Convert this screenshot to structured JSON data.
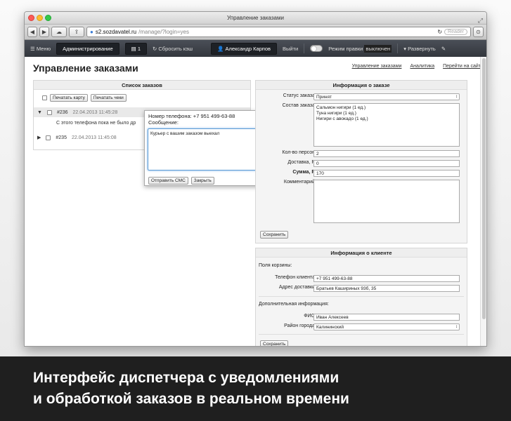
{
  "window": {
    "title": "Управление заказами"
  },
  "browser": {
    "url_host": "s2.sozdavatel.ru",
    "url_path": "/manage/?login=yes",
    "reader_label": "Reader"
  },
  "adminbar": {
    "menu": "Меню",
    "admin": "Администрирование",
    "badge": "1",
    "reset_cache": "Сбросить кэш",
    "user": "Александр Карпов",
    "logout": "Выйти",
    "edit_mode_label": "Режим правки",
    "edit_mode_state": "выключен",
    "expand": "Развернуть"
  },
  "page": {
    "title": "Управление заказами",
    "links": [
      "Управление заказами",
      "Аналитика",
      "Перейти на сайт"
    ]
  },
  "orders": {
    "title": "Список заказов",
    "print_card": "Печатать карту",
    "print_checks": "Печатать чеки",
    "rows": [
      {
        "arrow": "▼",
        "id": "#236",
        "date": "22.04.2013 11:45:28"
      },
      {
        "arrow": "▶",
        "id": "#235",
        "date": "22.04.2013 11:45:08"
      }
    ],
    "no_orders_note": "С этого телефона пока не было др"
  },
  "popup": {
    "phone_label": "Номер телефона: +7 951 499-63-88",
    "message_label": "Сообщение:",
    "message": "Курьер с вашим заказом выехал",
    "send_sms": "Отправить СМС",
    "close": "Закрыть"
  },
  "order_info": {
    "title": "Информация о заказе",
    "status_label": "Статус заказа",
    "status_value": "Принят",
    "composition_label": "Состав заказа",
    "composition_lines": [
      "Сальмон нигири (1 ед.)",
      "Туна нигири (1 ед.)",
      "Нигири с авокадо (1 ед.)"
    ],
    "persons_label": "Кол-во персон",
    "persons_value": "2",
    "delivery_label": "Доставка, Р",
    "delivery_value": "0",
    "sum_label": "Сумма, Р",
    "sum_value": "170",
    "comment_label": "Комментарий",
    "save": "Сохранить"
  },
  "client_info": {
    "title": "Информация о клиенте",
    "basket_fields": "Поля корзины:",
    "phone_label": "Телефон клиента",
    "phone_value": "+7 951 499-63-88",
    "address_label": "Адрес доставки",
    "address_value": "Братьев Кашириных 93б, 35",
    "additional": "Дополнительная информация:",
    "fio_label": "ФИО",
    "fio_value": "Иван Алексеев",
    "district_label": "Район города",
    "district_value": "Калининский",
    "save": "Сохранить"
  },
  "caption": {
    "line1": "Интерфейс диспетчера с уведомлениями",
    "line2": "и обработкой заказов в реальном времени"
  }
}
